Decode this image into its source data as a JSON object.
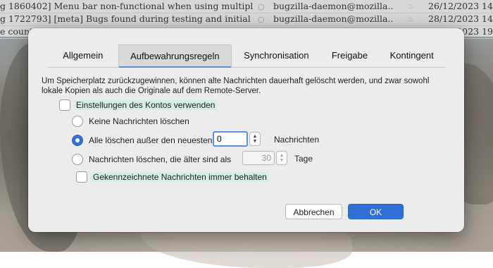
{
  "mail_list": {
    "rows": [
      {
        "subject": "g 1860402] Menu bar non-functional when using multiple...",
        "from": "bugzilla-daemon@mozilla...",
        "date": "26/12/2023 14"
      },
      {
        "subject": "g 1722793] [meta] Bugs found during testing and initial r...",
        "from": "bugzilla-daemon@mozilla...",
        "date": "28/12/2023 14"
      },
      {
        "subject": "e count",
        "from": "",
        "date": "22/12/2023 19"
      }
    ]
  },
  "dialog": {
    "tabs": [
      "Allgemein",
      "Aufbewahrungsregeln",
      "Synchronisation",
      "Freigabe",
      "Kontingent"
    ],
    "active_tab": "Aufbewahrungsregeln",
    "description": "Um Speicherplatz zurückzugewinnen, können alte Nachrichten dauerhaft gelöscht werden, und zwar sowohl lokale Kopien als auch die Originale auf dem Remote-Server.",
    "use_account_settings": "Einstellungen des Kontos verwenden",
    "options": {
      "keep_all": "Keine Nachrichten löschen",
      "keep_newest": "Alle löschen außer den neuesten",
      "keep_newest_value": "0",
      "keep_newest_suffix": "Nachrichten",
      "older_than": "Nachrichten löschen, die älter sind als",
      "older_than_value": "30",
      "older_than_suffix": "Tage"
    },
    "keep_flagged": "Gekennzeichnete Nachrichten immer behalten",
    "cancel_label": "Abbrechen",
    "ok_label": "OK",
    "accent_color": "#2f6fd6"
  }
}
